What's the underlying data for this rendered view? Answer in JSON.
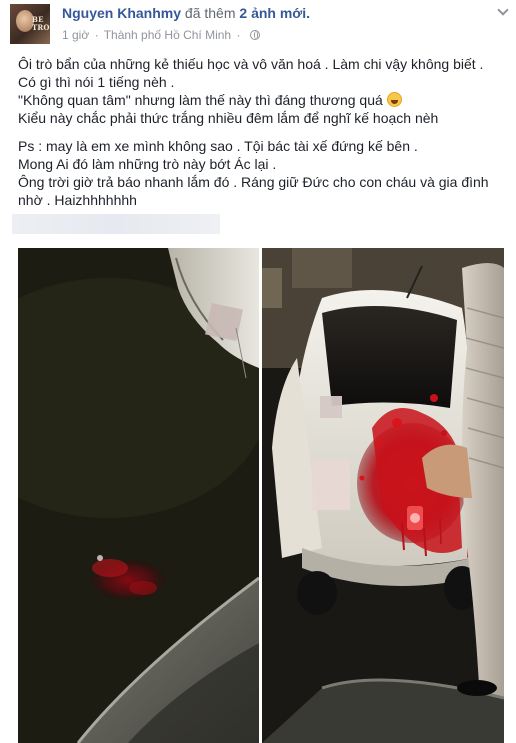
{
  "post": {
    "author": "Nguyen Khanhmy",
    "action": "đã thêm",
    "action_link": "2 ảnh mới.",
    "time": "1 giờ",
    "separator": "·",
    "location": "Thành phố Hồ Chí Minh",
    "lines": [
      "Ôi trò bẩn của những kẻ thiếu học và vô văn hoá . Làm chi vậy không biết .",
      "Có gì thì nói 1 tiếng nèh .",
      "\"Không quan tâm\" nhưng làm thế này thì đáng thương quá",
      "Kiểu này chắc phải thức trắng nhiều đêm lắm để nghĩ kế hoạch nèh",
      "Ps : may là em xe mình không sao . Tội bác tài xế đứng kế bên .",
      "Mong Ai đó làm những trò này bớt Ác lại .",
      "Ông trời giờ trả báo nhanh lắm đó . Ráng giữ Đức cho con cháu và gia đình nhờ . Haizhhhhhhh"
    ],
    "avatar_text": "BE\nTRONG"
  },
  "icons": {
    "avatar": "profile-picture",
    "menu": "chevron-down-icon",
    "privacy": "globe-icon",
    "emoji": "laughing-emoji-icon"
  },
  "colors": {
    "link": "#365899",
    "meta": "#90949c",
    "text": "#1d2129",
    "blood": "#c8141a"
  }
}
